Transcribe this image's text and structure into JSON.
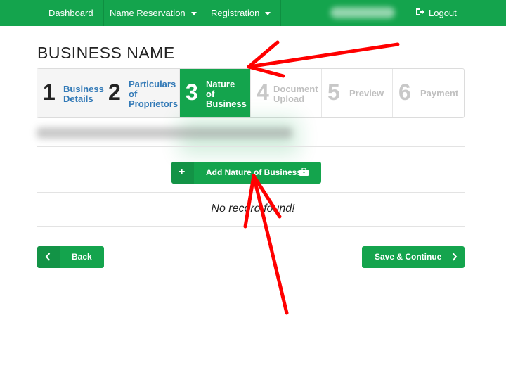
{
  "nav": {
    "dashboard": "Dashboard",
    "name_reservation": "Name Reservation",
    "registration": "Registration",
    "logout": "Logout",
    "logout_icon": "sign-out-icon"
  },
  "page": {
    "title": "BUSINESS NAME"
  },
  "steps": [
    {
      "num": "1",
      "label_lines": [
        "Business",
        "Details"
      ],
      "state": "done"
    },
    {
      "num": "2",
      "label_lines": [
        "Particulars",
        "of",
        "Proprietors"
      ],
      "state": "done"
    },
    {
      "num": "3",
      "label_lines": [
        "Nature",
        "of",
        "Business"
      ],
      "state": "active"
    },
    {
      "num": "4",
      "label_lines": [
        "Document",
        "Upload"
      ],
      "state": "todo"
    },
    {
      "num": "5",
      "label_lines": [
        "Preview"
      ],
      "state": "todo"
    },
    {
      "num": "6",
      "label_lines": [
        "Payment"
      ],
      "state": "todo"
    }
  ],
  "actions": {
    "add_label": "Add Nature of Business",
    "add_icon": "plus-icon",
    "add_trailing_icon": "briefcase-icon",
    "empty_message": "No record found!",
    "back_label": "Back",
    "save_label": "Save & Continue"
  },
  "colors": {
    "brand": "#14a44d",
    "link": "#337ab7",
    "annotation": "#ff0000"
  }
}
